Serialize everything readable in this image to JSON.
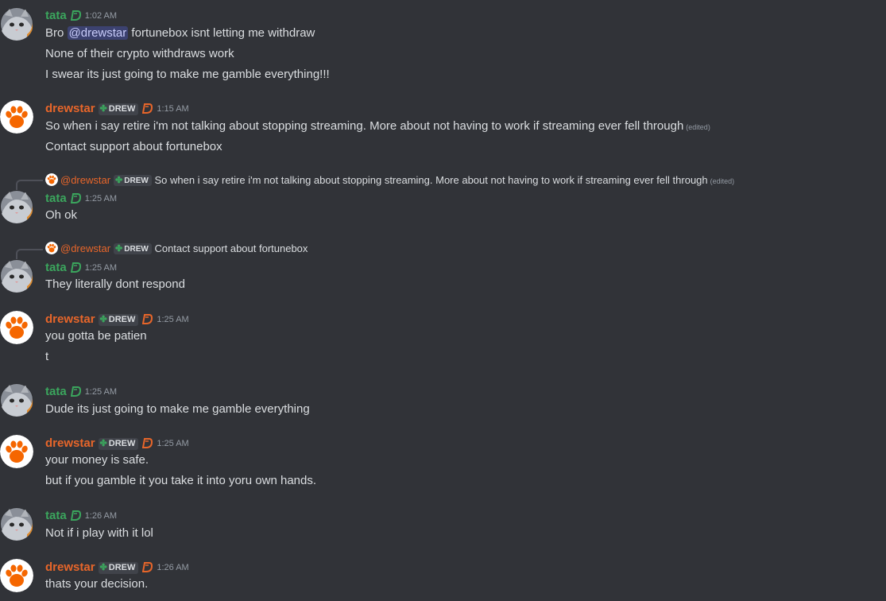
{
  "users": {
    "tata": {
      "name": "tata",
      "color": "#3ba55d"
    },
    "drew": {
      "name": "drewstar",
      "color": "#e8662a",
      "tag": "DREW"
    }
  },
  "messages": [
    {
      "user": "tata",
      "time": "1:02 AM",
      "lines": [
        {
          "pre": "Bro ",
          "mention": "@drewstar",
          "post": " fortunebox isnt letting me withdraw"
        },
        {
          "text": "None of their crypto withdraws work"
        },
        {
          "text": "I swear its just going to make me gamble everything!!!"
        }
      ]
    },
    {
      "user": "drew",
      "time": "1:15 AM",
      "lines": [
        {
          "text": "So when i say retire i'm not talking about stopping streaming. More about not having to work if streaming ever fell through",
          "edited": "(edited)"
        },
        {
          "text": "Contact support about fortunebox"
        }
      ]
    },
    {
      "user": "tata",
      "time": "1:25 AM",
      "reply": {
        "name": "@drewstar",
        "tag": "DREW",
        "text": "So when i say retire i'm not talking about stopping streaming. More about not having to work if streaming ever fell through",
        "edited": "(edited)"
      },
      "lines": [
        {
          "text": "Oh ok"
        }
      ]
    },
    {
      "user": "tata",
      "time": "1:25 AM",
      "reply": {
        "name": "@drewstar",
        "tag": "DREW",
        "text": "Contact support about fortunebox"
      },
      "lines": [
        {
          "text": "They literally dont respond"
        }
      ]
    },
    {
      "user": "drew",
      "time": "1:25 AM",
      "lines": [
        {
          "text": "you gotta be patien"
        },
        {
          "text": "t"
        }
      ]
    },
    {
      "user": "tata",
      "time": "1:25 AM",
      "lines": [
        {
          "text": "Dude its just going to make me gamble everything"
        }
      ]
    },
    {
      "user": "drew",
      "time": "1:25 AM",
      "lines": [
        {
          "text": "your money is safe."
        },
        {
          "text": "but if you gamble it you take it into yoru own hands."
        }
      ]
    },
    {
      "user": "tata",
      "time": "1:26 AM",
      "lines": [
        {
          "text": "Not if i play with it lol"
        }
      ]
    },
    {
      "user": "drew",
      "time": "1:26 AM",
      "lines": [
        {
          "text": "thats your decision."
        }
      ]
    }
  ]
}
